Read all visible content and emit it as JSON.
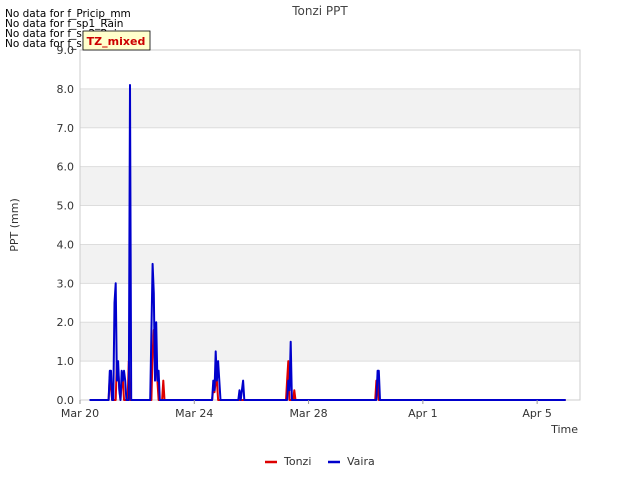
{
  "no_data_messages": [
    "No data for f_Pricip_mm",
    "No data for f_sp1_Rain",
    "No data for f_sp2_Rain",
    "No data for f_sp3_Rain"
  ],
  "badge": {
    "label": "TZ_mixed",
    "bg": "#ffffcc",
    "color": "#cc0000"
  },
  "chart_data": {
    "type": "line",
    "title": "Tonzi PPT",
    "xlabel": "Time",
    "ylabel": "PPT (mm)",
    "xlim": [
      "2023-03-20",
      "2023-04-06T12:00"
    ],
    "ylim": [
      0,
      9
    ],
    "yticks": [
      "0.0",
      "1.0",
      "2.0",
      "3.0",
      "4.0",
      "5.0",
      "6.0",
      "7.0",
      "8.0",
      "9.0"
    ],
    "xticks": [
      {
        "date": "2023-03-20",
        "label": "Mar 20"
      },
      {
        "date": "2023-03-24",
        "label": "Mar 24"
      },
      {
        "date": "2023-03-28",
        "label": "Mar 28"
      },
      {
        "date": "2023-04-01",
        "label": "Apr 1"
      },
      {
        "date": "2023-04-05",
        "label": "Apr 5"
      }
    ],
    "grid": true,
    "band_color": "#f2f2f2",
    "legend_position": "bottom-center",
    "series": [
      {
        "name": "Tonzi",
        "color": "#dd0000",
        "points": [
          [
            "2023-03-20T08:00",
            0
          ],
          [
            "2023-03-21T00:00",
            0
          ],
          [
            "2023-03-21T01:00",
            0.6
          ],
          [
            "2023-03-21T02:00",
            0.3
          ],
          [
            "2023-03-21T03:00",
            0
          ],
          [
            "2023-03-21T06:00",
            0
          ],
          [
            "2023-03-21T07:00",
            1.0
          ],
          [
            "2023-03-21T08:00",
            0.8
          ],
          [
            "2023-03-21T09:00",
            0.3
          ],
          [
            "2023-03-21T10:00",
            0
          ],
          [
            "2023-03-21T11:00",
            0.5
          ],
          [
            "2023-03-21T12:00",
            0.5
          ],
          [
            "2023-03-21T13:00",
            0
          ],
          [
            "2023-03-21T16:00",
            0
          ],
          [
            "2023-03-21T17:00",
            1.0
          ],
          [
            "2023-03-21T18:00",
            0
          ],
          [
            "2023-03-22T12:00",
            0
          ],
          [
            "2023-03-22T13:00",
            1.2
          ],
          [
            "2023-03-22T14:00",
            1.8
          ],
          [
            "2023-03-22T15:00",
            1.0
          ],
          [
            "2023-03-22T16:00",
            1.0
          ],
          [
            "2023-03-22T17:00",
            0.5
          ],
          [
            "2023-03-22T18:00",
            0
          ],
          [
            "2023-03-22T21:00",
            0
          ],
          [
            "2023-03-22T22:00",
            0.5
          ],
          [
            "2023-03-22T23:00",
            0
          ],
          [
            "2023-03-24T15:00",
            0
          ],
          [
            "2023-03-24T16:00",
            0.3
          ],
          [
            "2023-03-24T17:00",
            0.2
          ],
          [
            "2023-03-24T18:00",
            0.5
          ],
          [
            "2023-03-24T19:00",
            0.5
          ],
          [
            "2023-03-24T20:00",
            0
          ],
          [
            "2023-03-27T05:00",
            0
          ],
          [
            "2023-03-27T06:00",
            0.5
          ],
          [
            "2023-03-27T07:00",
            1.0
          ],
          [
            "2023-03-27T08:00",
            0
          ],
          [
            "2023-03-27T11:00",
            0
          ],
          [
            "2023-03-27T12:00",
            0.25
          ],
          [
            "2023-03-27T13:00",
            0
          ],
          [
            "2023-03-30T08:00",
            0
          ],
          [
            "2023-03-30T09:00",
            0.5
          ],
          [
            "2023-03-30T10:00",
            0.5
          ],
          [
            "2023-03-30T11:00",
            0
          ],
          [
            "2023-04-06T00:00",
            0
          ]
        ]
      },
      {
        "name": "Vaira",
        "color": "#0000cc",
        "points": [
          [
            "2023-03-20T08:00",
            0
          ],
          [
            "2023-03-21T00:00",
            0
          ],
          [
            "2023-03-21T01:00",
            0.75
          ],
          [
            "2023-03-21T02:00",
            0.75
          ],
          [
            "2023-03-21T03:00",
            0
          ],
          [
            "2023-03-21T04:00",
            0
          ],
          [
            "2023-03-21T05:00",
            2.5
          ],
          [
            "2023-03-21T06:00",
            3.0
          ],
          [
            "2023-03-21T07:00",
            0.5
          ],
          [
            "2023-03-21T08:00",
            1.0
          ],
          [
            "2023-03-21T09:00",
            0.25
          ],
          [
            "2023-03-21T10:00",
            0
          ],
          [
            "2023-03-21T11:00",
            0.75
          ],
          [
            "2023-03-21T12:00",
            0.5
          ],
          [
            "2023-03-21T13:00",
            0.75
          ],
          [
            "2023-03-21T14:00",
            0.5
          ],
          [
            "2023-03-21T15:00",
            0
          ],
          [
            "2023-03-21T17:00",
            0
          ],
          [
            "2023-03-21T18:00",
            8.1
          ],
          [
            "2023-03-21T19:00",
            0
          ],
          [
            "2023-03-22T11:00",
            0
          ],
          [
            "2023-03-22T12:00",
            1.75
          ],
          [
            "2023-03-22T13:00",
            3.5
          ],
          [
            "2023-03-22T14:00",
            2.75
          ],
          [
            "2023-03-22T15:00",
            0.5
          ],
          [
            "2023-03-22T16:00",
            2.0
          ],
          [
            "2023-03-22T17:00",
            0.5
          ],
          [
            "2023-03-22T18:00",
            0.75
          ],
          [
            "2023-03-22T19:00",
            0
          ],
          [
            "2023-03-24T15:00",
            0
          ],
          [
            "2023-03-24T16:00",
            0.5
          ],
          [
            "2023-03-24T17:00",
            0.25
          ],
          [
            "2023-03-24T18:00",
            1.25
          ],
          [
            "2023-03-24T19:00",
            0.5
          ],
          [
            "2023-03-24T20:00",
            1.0
          ],
          [
            "2023-03-24T21:00",
            0.5
          ],
          [
            "2023-03-24T22:00",
            0
          ],
          [
            "2023-03-25T13:00",
            0
          ],
          [
            "2023-03-25T14:00",
            0.25
          ],
          [
            "2023-03-25T15:00",
            0
          ],
          [
            "2023-03-25T16:00",
            0.25
          ],
          [
            "2023-03-25T17:00",
            0.5
          ],
          [
            "2023-03-25T18:00",
            0
          ],
          [
            "2023-03-27T06:00",
            0
          ],
          [
            "2023-03-27T07:00",
            0.5
          ],
          [
            "2023-03-27T08:00",
            0.25
          ],
          [
            "2023-03-27T09:00",
            1.5
          ],
          [
            "2023-03-27T10:00",
            0
          ],
          [
            "2023-03-30T09:00",
            0
          ],
          [
            "2023-03-30T10:00",
            0.75
          ],
          [
            "2023-03-30T11:00",
            0.75
          ],
          [
            "2023-03-30T12:00",
            0
          ],
          [
            "2023-04-06T00:00",
            0
          ]
        ]
      }
    ]
  }
}
